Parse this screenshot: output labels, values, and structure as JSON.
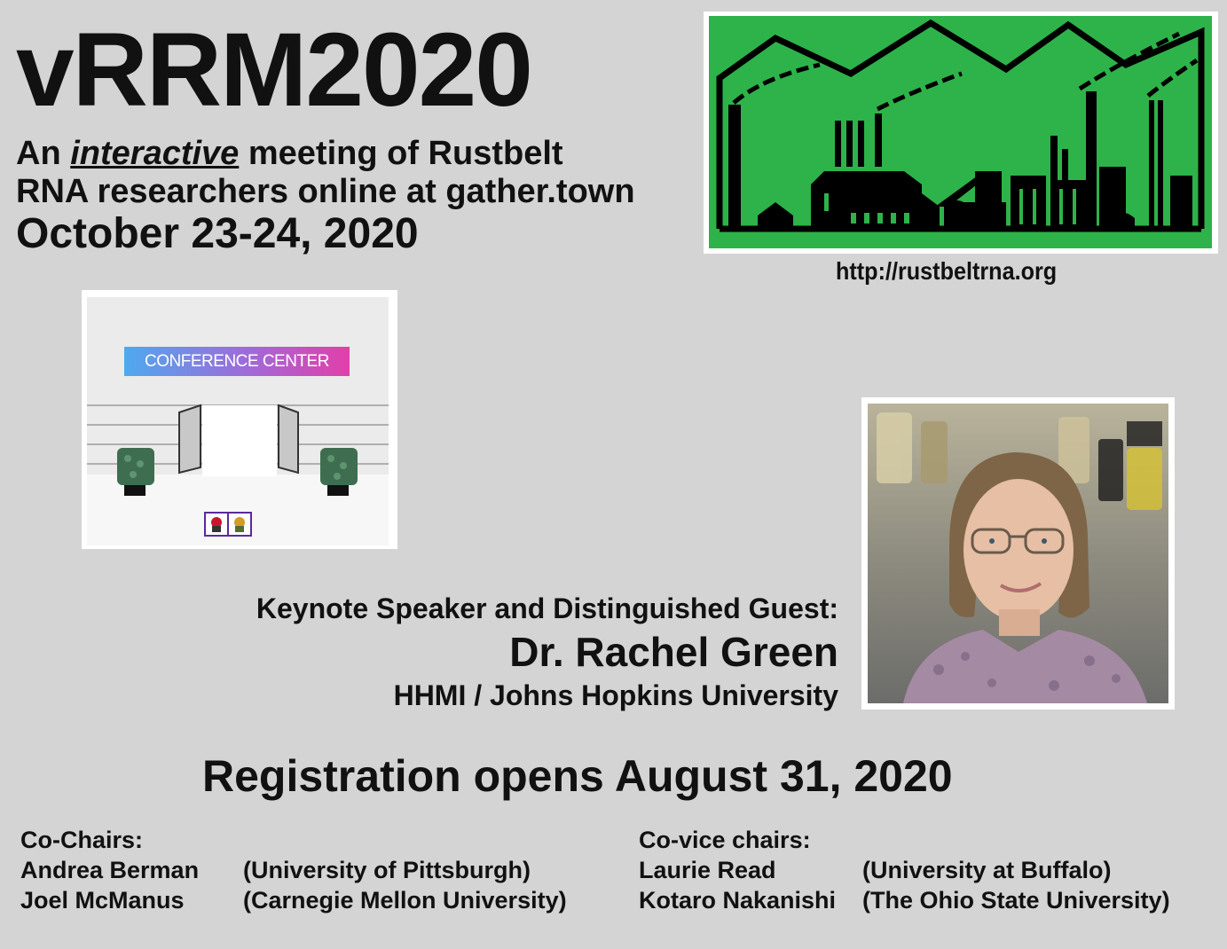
{
  "header": {
    "title": "vRRM2020",
    "subtitle_pre": "An ",
    "subtitle_em": "interactive",
    "subtitle_post": " meeting of Rustbelt",
    "subtitle_line2": "RNA researchers online at gather.town",
    "date": "October 23-24, 2020"
  },
  "logo": {
    "icon": "factory-skyline-icon",
    "bg_color": "#2db34a",
    "url": "http://rustbeltrna.org"
  },
  "gather_town": {
    "sign_text": "CONFERENCE CENTER"
  },
  "keynote": {
    "label": "Keynote Speaker and Distinguished Guest:",
    "name": "Dr. Rachel Green",
    "affiliation": "HHMI / Johns Hopkins University"
  },
  "registration": {
    "text": "Registration opens August 31, 2020"
  },
  "cochairs": {
    "heading": "Co-Chairs:",
    "people": [
      {
        "name": "Andrea Berman",
        "affiliation": "(University of Pittsburgh)"
      },
      {
        "name": "Joel McManus",
        "affiliation": "(Carnegie Mellon University)"
      }
    ]
  },
  "covice_chairs": {
    "heading": "Co-vice chairs:",
    "people": [
      {
        "name": "Laurie Read",
        "affiliation": "(University at Buffalo)"
      },
      {
        "name": "Kotaro Nakanishi",
        "affiliation": "(The Ohio State University)"
      }
    ]
  }
}
